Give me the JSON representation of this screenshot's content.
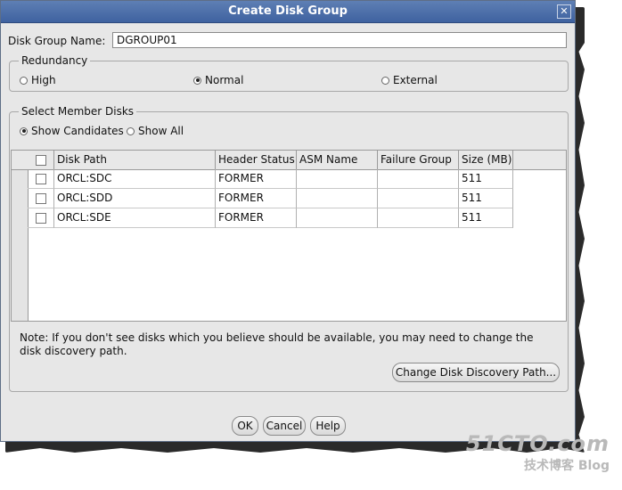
{
  "window": {
    "title": "Create Disk Group",
    "close_glyph": "✕"
  },
  "form": {
    "name_label": "Disk Group Name:",
    "name_value": "DGROUP01"
  },
  "redundancy": {
    "legend": "Redundancy",
    "options": [
      {
        "label": "High",
        "selected": false
      },
      {
        "label": "Normal",
        "selected": true
      },
      {
        "label": "External",
        "selected": false
      }
    ]
  },
  "member_disks": {
    "legend": "Select Member Disks",
    "filters": [
      {
        "label": "Show Candidates",
        "selected": true
      },
      {
        "label": "Show All",
        "selected": false
      }
    ],
    "columns": [
      "Disk Path",
      "Header Status",
      "ASM Name",
      "Failure Group",
      "Size (MB)"
    ],
    "rows": [
      {
        "checked": false,
        "disk_path": "ORCL:SDC",
        "header_status": "FORMER",
        "asm_name": "",
        "failure_group": "",
        "size": "511"
      },
      {
        "checked": false,
        "disk_path": "ORCL:SDD",
        "header_status": "FORMER",
        "asm_name": "",
        "failure_group": "",
        "size": "511"
      },
      {
        "checked": false,
        "disk_path": "ORCL:SDE",
        "header_status": "FORMER",
        "asm_name": "",
        "failure_group": "",
        "size": "511"
      }
    ],
    "note": "Note: If you don't see disks which you believe should be available, you may need to change the disk discovery path.",
    "discovery_button": "Change Disk Discovery Path..."
  },
  "buttons": {
    "ok": "OK",
    "cancel": "Cancel",
    "help": "Help"
  },
  "watermark": {
    "line1": "51CTO.com",
    "line2": "技术博客 Blog"
  }
}
